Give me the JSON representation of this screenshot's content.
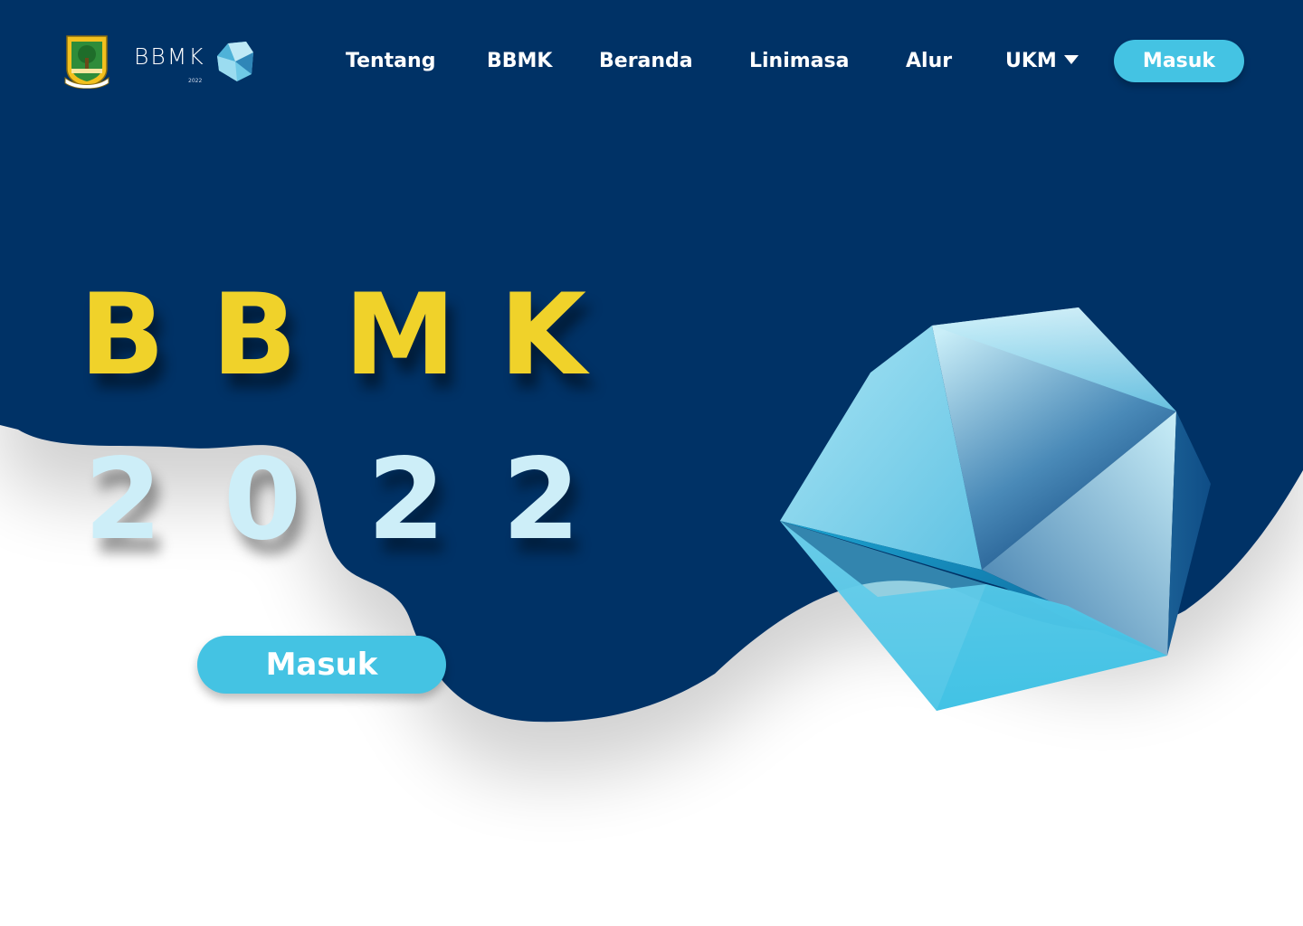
{
  "header": {
    "brand_title": "BBMK",
    "brand_year": "2022",
    "nav": [
      {
        "label": "Tentang"
      },
      {
        "label": "BBMK"
      },
      {
        "label": "Beranda"
      },
      {
        "label": "Linimasa"
      },
      {
        "label": "Alur"
      },
      {
        "label": "UKM",
        "has_dropdown": true
      }
    ],
    "login_label": "Masuk"
  },
  "hero": {
    "title_letters": [
      "B",
      "B",
      "M",
      "K"
    ],
    "year_digits": [
      "2",
      "0",
      "2",
      "2"
    ],
    "login_label": "Masuk"
  },
  "icons": {
    "emblem": "regional-emblem-icon",
    "brand_gem": "crystal-gem-icon",
    "dropdown": "caret-down-icon",
    "hero_illustration": "crystal-illustration"
  },
  "colors": {
    "background_navy": "#023366",
    "accent_yellow": "#f0d22a",
    "accent_light_blue": "#cdeef8",
    "button_cyan": "#44c3e3",
    "text_white": "#ffffff"
  }
}
